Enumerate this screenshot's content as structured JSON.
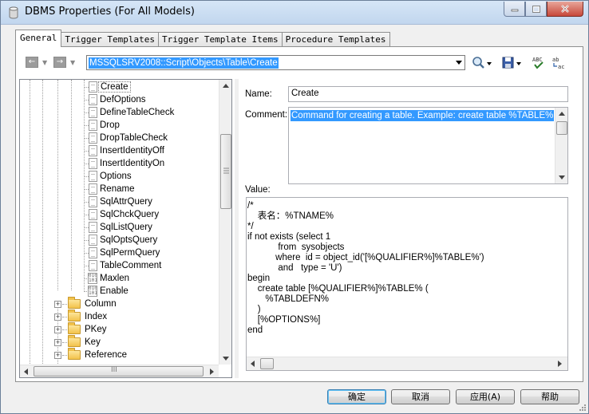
{
  "window": {
    "title": "DBMS Properties (For All Models)"
  },
  "tabs": [
    {
      "label": "General",
      "active": true
    },
    {
      "label": "Trigger Templates",
      "active": false
    },
    {
      "label": "Trigger Template Items",
      "active": false
    },
    {
      "label": "Procedure Templates",
      "active": false
    }
  ],
  "toolbar": {
    "back_glyph": "←",
    "forward_glyph": "→",
    "path": "MSSQLSRV2008::Script\\Objects\\Table\\Create",
    "icons": [
      "find-icon",
      "save-icon",
      "spell-check-icon",
      "replace-icon"
    ]
  },
  "tree": {
    "selected": "Create",
    "leaf_items": [
      {
        "label": "Create",
        "kind": "doc"
      },
      {
        "label": "DefOptions",
        "kind": "doc"
      },
      {
        "label": "DefineTableCheck",
        "kind": "doc"
      },
      {
        "label": "Drop",
        "kind": "doc"
      },
      {
        "label": "DropTableCheck",
        "kind": "doc"
      },
      {
        "label": "InsertIdentityOff",
        "kind": "doc"
      },
      {
        "label": "InsertIdentityOn",
        "kind": "doc"
      },
      {
        "label": "Options",
        "kind": "doc"
      },
      {
        "label": "Rename",
        "kind": "doc"
      },
      {
        "label": "SqlAttrQuery",
        "kind": "doc"
      },
      {
        "label": "SqlChckQuery",
        "kind": "doc"
      },
      {
        "label": "SqlListQuery",
        "kind": "doc"
      },
      {
        "label": "SqlOptsQuery",
        "kind": "doc"
      },
      {
        "label": "SqlPermQuery",
        "kind": "doc"
      },
      {
        "label": "TableComment",
        "kind": "doc"
      },
      {
        "label": "Maxlen",
        "kind": "binary"
      },
      {
        "label": "Enable",
        "kind": "binary"
      }
    ],
    "folders": [
      {
        "label": "Column"
      },
      {
        "label": "Index"
      },
      {
        "label": "PKey"
      },
      {
        "label": "Key"
      },
      {
        "label": "Reference"
      }
    ],
    "scroll_thumb_label": "III"
  },
  "details": {
    "name_label": "Name:",
    "name_value": "Create",
    "comment_label": "Comment:",
    "comment_value": "Command for creating a table. Example: create table %TABLE%",
    "value_label": "Value:",
    "value_lines": [
      "/*",
      "    表名：%TNAME%",
      "*/",
      "if not exists (select 1",
      "            from  sysobjects",
      "           where  id = object_id('[%QUALIFIER%]%TABLE%')",
      "            and   type = 'U')",
      "begin",
      "    create table [%QUALIFIER%]%TABLE% (",
      "       %TABLDEFN%",
      "    )",
      "    [%OPTIONS%]",
      "end"
    ]
  },
  "buttons": {
    "ok": "确定",
    "cancel": "取消",
    "apply": "应用(A)",
    "help": "帮助"
  },
  "colors": {
    "selection": "#3399ff",
    "titlebar": "#c1d6ee",
    "close_button": "#c7483a"
  }
}
